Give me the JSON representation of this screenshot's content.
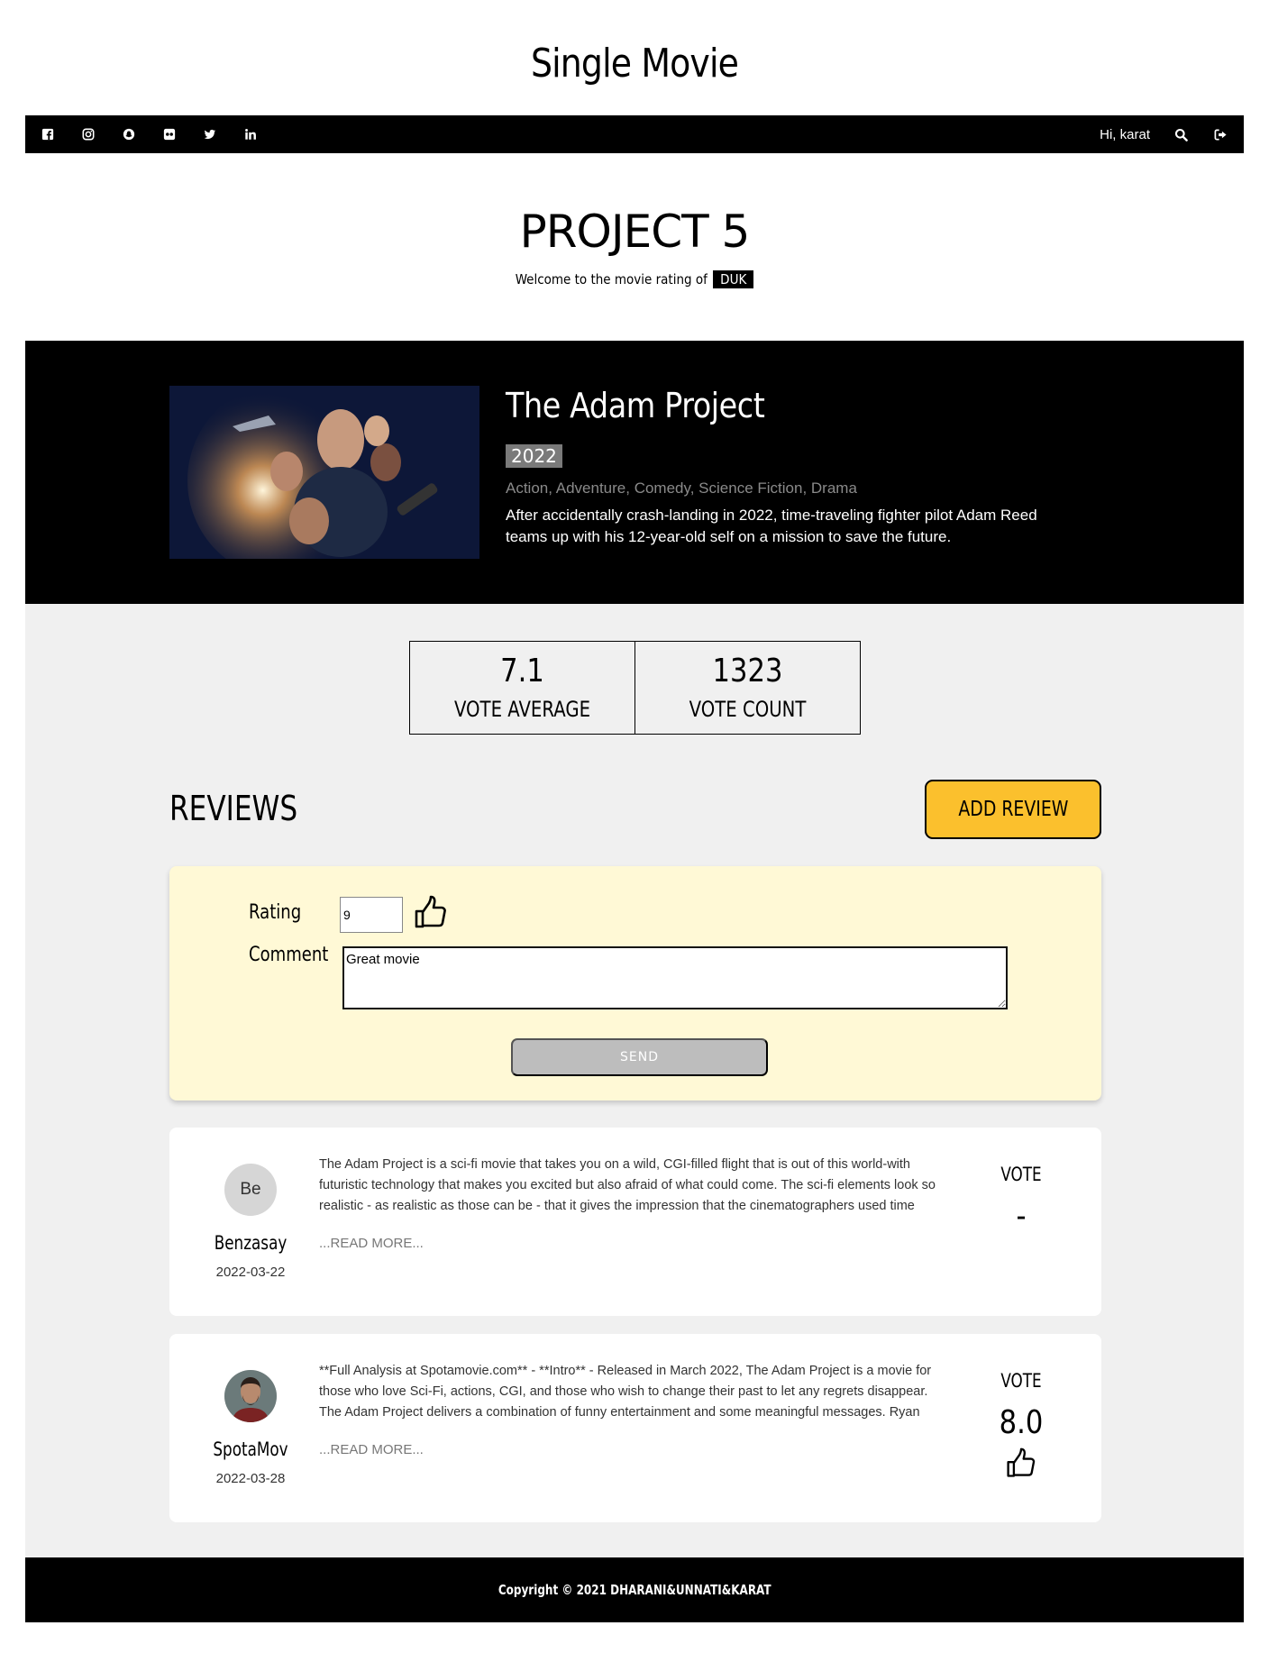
{
  "page": {
    "heading": "Single Movie"
  },
  "topbar": {
    "social_icons": [
      "facebook-icon",
      "instagram-icon",
      "snapchat-icon",
      "flickr-icon",
      "twitter-icon",
      "linkedin-icon"
    ],
    "greeting": "Hi, karat",
    "icons": [
      "search-icon",
      "sign-out-icon"
    ]
  },
  "brand": {
    "title": "PROJECT 5",
    "subtitle": "Welcome to the movie rating of",
    "badge": "DUK"
  },
  "movie": {
    "title": "The Adam Project",
    "year": "2022",
    "genres": "Action, Adventure, Comedy, Science Fiction, Drama",
    "overview": "After accidentally crash-landing in 2022, time-traveling fighter pilot Adam Reed teams up with his 12-year-old self on a mission to save the future."
  },
  "stats": {
    "vote_average": "7.1",
    "vote_average_label": "VOTE AVERAGE",
    "vote_count": "1323",
    "vote_count_label": "VOTE COUNT"
  },
  "reviews": {
    "heading": "REVIEWS",
    "add_label": "ADD REVIEW",
    "form": {
      "rating_label": "Rating",
      "rating_value": "9",
      "comment_label": "Comment",
      "comment_value": "Great movie",
      "send_label": "SEND"
    },
    "items": [
      {
        "initials": "Be",
        "author": "Benzasay",
        "date": "2022-03-22",
        "text": "The Adam Project is a sci-fi movie that takes you on a wild, CGI-filled flight that is out of this world-with futuristic technology that makes you excited but also afraid of what could come. The sci-fi elements look so realistic - as realistic as those can be - that it gives the impression that the cinematographers used time",
        "read_more": "...READ MORE...",
        "vote_label": "VOTE",
        "vote": "-"
      },
      {
        "initials": "",
        "author": "SpotaMov",
        "date": "2022-03-28",
        "text": "**Full Analysis at Spotamovie.com** - **Intro** - Released in March 2022, The Adam Project is a movie for those who love Sci-Fi, actions, CGI, and those who wish to change their past to let any regrets disappear. The Adam Project delivers a combination of funny entertainment and some meaningful messages. Ryan",
        "read_more": "...READ MORE...",
        "vote_label": "VOTE",
        "vote": "8.0"
      }
    ]
  },
  "footer": {
    "copyright": "Copyright © 2021 DHARANI&UNNATI&KARAT"
  }
}
